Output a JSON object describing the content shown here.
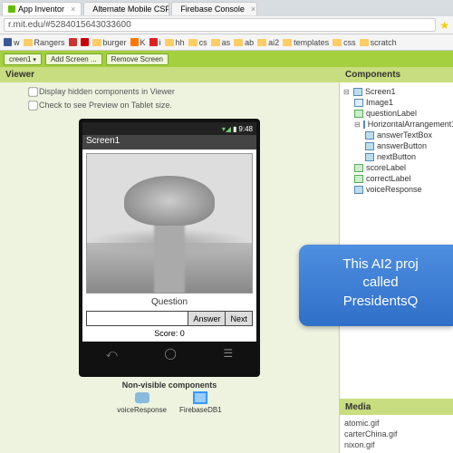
{
  "browser": {
    "tabs": [
      {
        "title": "App Inventor"
      },
      {
        "title": "Alternate Mobile CSP co..."
      },
      {
        "title": "Firebase Console"
      }
    ],
    "url": "r.mit.edu/#5284015643033600",
    "bookmarks": [
      "w",
      "Rangers",
      "burger",
      "K",
      "i",
      "hh",
      "cs",
      "as",
      "ab",
      "ai2",
      "templates",
      "css",
      "scratch"
    ]
  },
  "ai_toolbar": {
    "screen_sel": "creen1",
    "add_screen": "Add Screen ...",
    "remove_screen": "Remove Screen"
  },
  "viewer": {
    "title": "Viewer",
    "opt_hidden": "Display hidden components in Viewer",
    "opt_tablet": "Check to see Preview on Tablet size.",
    "status_time": "9:48",
    "appbar_title": "Screen1",
    "question_label": "Question",
    "answer_btn": "Answer",
    "next_btn": "Next",
    "score_label": "Score: 0",
    "nonvis_title": "Non-visible components",
    "nonvis_items": [
      "voiceResponse",
      "FirebaseDB1"
    ]
  },
  "components": {
    "title": "Components",
    "tree": [
      {
        "level": 0,
        "type": "screen",
        "label": "Screen1",
        "expandable": true
      },
      {
        "level": 1,
        "type": "image",
        "label": "Image1"
      },
      {
        "level": 1,
        "type": "label",
        "label": "questionLabel"
      },
      {
        "level": 1,
        "type": "arrange",
        "label": "HorizontalArrangement1",
        "expandable": true
      },
      {
        "level": 2,
        "type": "textbox",
        "label": "answerTextBox"
      },
      {
        "level": 2,
        "type": "button",
        "label": "answerButton"
      },
      {
        "level": 2,
        "type": "button",
        "label": "nextButton"
      },
      {
        "level": 1,
        "type": "label",
        "label": "scoreLabel"
      },
      {
        "level": 1,
        "type": "label",
        "label": "correctLabel"
      },
      {
        "level": 1,
        "type": "comp",
        "label": "voiceResponse"
      }
    ]
  },
  "media": {
    "title": "Media",
    "items": [
      "atomic.gif",
      "carterChina.gif",
      "nixon.gif"
    ]
  },
  "callout": {
    "line1": "This AI2 proj",
    "line2": "called",
    "line3": " PresidentsQ"
  }
}
